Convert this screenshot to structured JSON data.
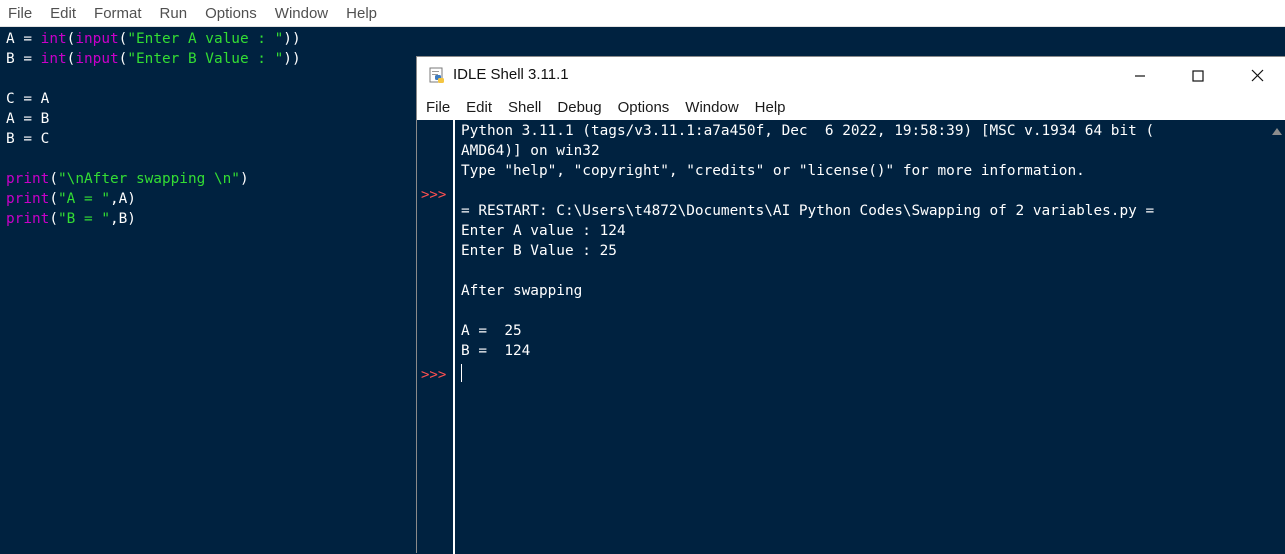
{
  "editor": {
    "menu": [
      "File",
      "Edit",
      "Format",
      "Run",
      "Options",
      "Window",
      "Help"
    ],
    "code": {
      "l1": {
        "a": "A = ",
        "b": "int",
        "c": "(",
        "d": "input",
        "e": "(",
        "f": "\"Enter A value : \"",
        "g": "))"
      },
      "l2": {
        "a": "B = ",
        "b": "int",
        "c": "(",
        "d": "input",
        "e": "(",
        "f": "\"Enter B Value : \"",
        "g": "))"
      },
      "l4": "C = A",
      "l5": "A = B",
      "l6": "B = C",
      "l8": {
        "a": "print",
        "b": "(",
        "c": "\"\\nAfter swapping \\n\"",
        "d": ")"
      },
      "l9": {
        "a": "print",
        "b": "(",
        "c": "\"A = \"",
        "d": ",A)"
      },
      "l10": {
        "a": "print",
        "b": "(",
        "c": "\"B = \"",
        "d": ",B)"
      }
    }
  },
  "shell": {
    "title": "IDLE Shell 3.11.1",
    "menu": [
      "File",
      "Edit",
      "Shell",
      "Debug",
      "Options",
      "Window",
      "Help"
    ],
    "prompt_symbol": ">>>",
    "output": [
      "Python 3.11.1 (tags/v3.11.1:a7a450f, Dec  6 2022, 19:58:39) [MSC v.1934 64 bit (",
      "AMD64)] on win32",
      "Type \"help\", \"copyright\", \"credits\" or \"license()\" for more information.",
      "",
      "= RESTART: C:\\Users\\t4872\\Documents\\AI Python Codes\\Swapping of 2 variables.py =",
      "Enter A value : 124",
      "Enter B Value : 25",
      "",
      "After swapping",
      "",
      "A =  25",
      "B =  124"
    ],
    "window_buttons": [
      "minimize-icon",
      "maximize-icon",
      "close-icon"
    ]
  },
  "colors": {
    "background": "#002240",
    "builtin": "#c800c8",
    "string": "#33dd33",
    "prompt": "#ff5050"
  }
}
